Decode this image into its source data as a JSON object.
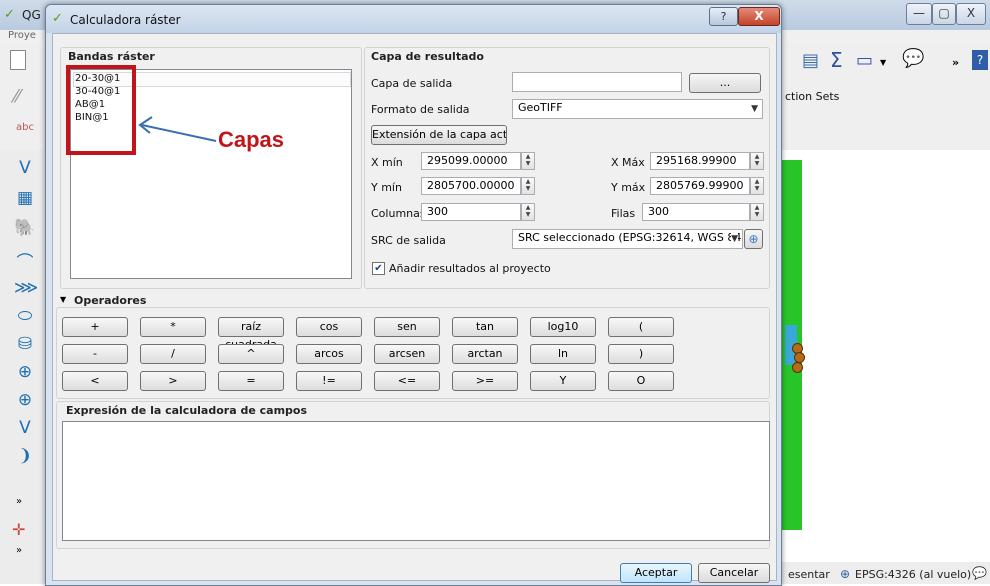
{
  "background": {
    "app_title": "QG",
    "menu_text": "Proye",
    "selection_sets": "ction Sets",
    "status_left": "esentar",
    "status_crs": "EPSG:4326 (al vuelo)",
    "window_buttons": [
      "—",
      "▢",
      "X"
    ]
  },
  "dialog": {
    "title": "Calculadora ráster",
    "help": "?",
    "close": "X"
  },
  "bands": {
    "title": "Bandas ráster",
    "items": [
      "20-30@1",
      "30-40@1",
      "AB@1",
      "BIN@1"
    ],
    "annotation": "Capas"
  },
  "result": {
    "title": "Capa de resultado",
    "output_layer_label": "Capa de salida",
    "output_layer_value": "",
    "browse": "...",
    "format_label": "Formato de salida",
    "format_value": "GeoTIFF",
    "extent_button": "Extensión de la capa actual",
    "xmin_label": "X mín",
    "xmin_value": "295099.00000",
    "xmax_label": "X Máx",
    "xmax_value": "295168.99900",
    "ymin_label": "Y mín",
    "ymin_value": "2805700.00000",
    "ymax_label": "Y máx",
    "ymax_value": "2805769.99900",
    "cols_label": "Columnas",
    "cols_value": "300",
    "rows_label": "Filas",
    "rows_value": "300",
    "crs_label": "SRC de salida",
    "crs_value": "SRC seleccionado (EPSG:32614, WGS 84 / U",
    "add_results": "Añadir resultados al proyecto",
    "add_results_checked": true
  },
  "operators": {
    "title": "Operadores",
    "rows": [
      [
        "+",
        "*",
        "raíz cuadrada",
        "cos",
        "sen",
        "tan",
        "log10",
        "("
      ],
      [
        "-",
        "/",
        "^",
        "arcos",
        "arcsen",
        "arctan",
        "ln",
        ")"
      ],
      [
        "<",
        ">",
        "=",
        "!=",
        "<=",
        ">=",
        "Y",
        "O"
      ]
    ]
  },
  "expression": {
    "title": "Expresión de la calculadora de campos",
    "value": ""
  },
  "footer": {
    "ok": "Aceptar",
    "cancel": "Cancelar"
  }
}
